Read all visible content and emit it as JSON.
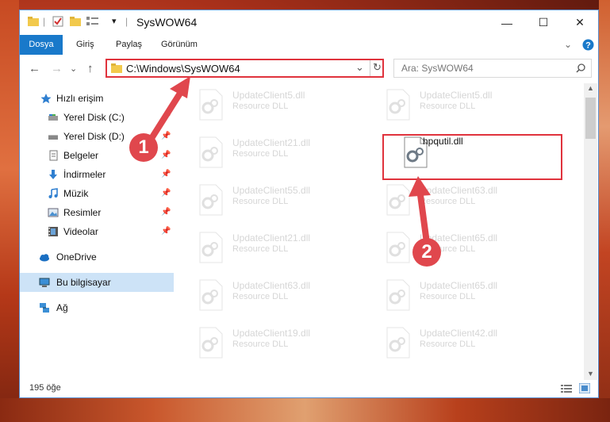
{
  "window": {
    "title": "SysWOW64",
    "controls": {
      "minimize": "—",
      "maximize": "☐",
      "close": "✕"
    }
  },
  "ribbon": {
    "tabs": [
      "Dosya",
      "Giriş",
      "Paylaş",
      "Görünüm"
    ]
  },
  "nav": {
    "back": "←",
    "forward": "→",
    "recent": "⌄",
    "up": "↑",
    "address": "C:\\Windows\\SysWOW64",
    "dropdown": "⌄",
    "refresh": "↻",
    "search_placeholder": "Ara: SysWOW64"
  },
  "sidebar": {
    "items": [
      {
        "label": "Hızlı erişim",
        "icon": "star-icon"
      },
      {
        "label": "Yerel Disk (C:)",
        "icon": "drive-icon"
      },
      {
        "label": "Yerel Disk (D:)",
        "icon": "drive-icon"
      },
      {
        "label": "Belgeler",
        "icon": "documents-icon"
      },
      {
        "label": "İndirmeler",
        "icon": "download-icon"
      },
      {
        "label": "Müzik",
        "icon": "music-icon"
      },
      {
        "label": "Resimler",
        "icon": "pictures-icon"
      },
      {
        "label": "Videolar",
        "icon": "videos-icon"
      },
      {
        "label": "OneDrive",
        "icon": "cloud-icon"
      },
      {
        "label": "Bu bilgisayar",
        "icon": "computer-icon"
      },
      {
        "label": "Ağ",
        "icon": "network-icon"
      }
    ]
  },
  "files": [
    {
      "name": "UpdateClient5.dll",
      "type": "Resource DLL"
    },
    {
      "name": "UpdateClient5.dll",
      "type": "Resource DLL"
    },
    {
      "name": "UpdateClient21.dll",
      "type": "Resource DLL"
    },
    {
      "name": "hpqutil.dll",
      "type": ""
    },
    {
      "name": "UpdateClient55.dll",
      "type": "Resource DLL"
    },
    {
      "name": "UpdateClient63.dll",
      "type": "Resource DLL"
    },
    {
      "name": "UpdateClient21.dll",
      "type": "Resource DLL"
    },
    {
      "name": "UpdateClient65.dll",
      "type": "Resource DLL"
    },
    {
      "name": "UpdateClient63.dll",
      "type": "Resource DLL"
    },
    {
      "name": "UpdateClient65.dll",
      "type": "Resource DLL"
    },
    {
      "name": "UpdateClient19.dll",
      "type": "Resource DLL"
    },
    {
      "name": "UpdateClient42.dll",
      "type": "Resource DLL"
    }
  ],
  "status": {
    "count": "195 öğe"
  },
  "callouts": [
    "1",
    "2"
  ],
  "colors": {
    "accent": "#1979ca",
    "highlight": "#e0333d",
    "callout": "#e0474d"
  }
}
